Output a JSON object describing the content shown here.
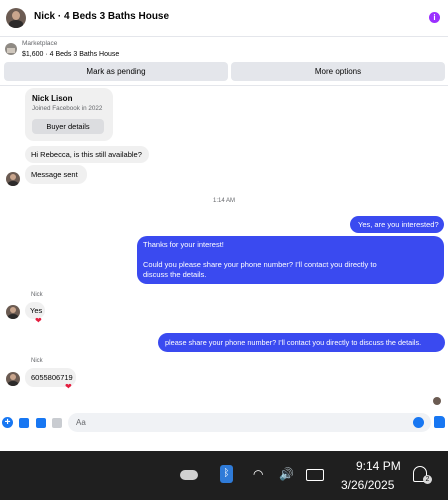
{
  "header": {
    "title": "Nick · 4 Beds 3 Baths House",
    "info_icon_label": "i"
  },
  "listing": {
    "label": "Marketplace",
    "title": "$1,600 · 4 Beds 3 Baths House",
    "mark_pending_label": "Mark as pending",
    "more_options_label": "More options"
  },
  "profile_card": {
    "name": "Nick Lison",
    "joined": "Joined Facebook in 2022",
    "buyer_details_label": "Buyer details"
  },
  "messages": {
    "m1": "Hi Rebecca, is this still available?",
    "m2": "Message sent",
    "time": "1:14 AM",
    "m3": "Yes, are you interested?",
    "m4_line1": "Thanks for your interest!",
    "m4_line2": "Could you please share your phone number? I'll contact you directly to discuss the details.",
    "sender1": "Nick",
    "m5": "Yes",
    "m6": "please share your phone number? I'll contact you directly to discuss the details.",
    "sender2": "Nick",
    "m7": "6055806719",
    "heart": "❤"
  },
  "composer": {
    "placeholder": "Aa",
    "send_icon": "thumbs-up-icon"
  },
  "taskbar": {
    "time": "9:14 PM",
    "date": "3/26/2025",
    "notif_count": "2"
  },
  "colors": {
    "accent": "#1877f2",
    "outgoing": "#3a4af0",
    "info": "#9b30ff",
    "taskbar": "#1f1f1f"
  }
}
